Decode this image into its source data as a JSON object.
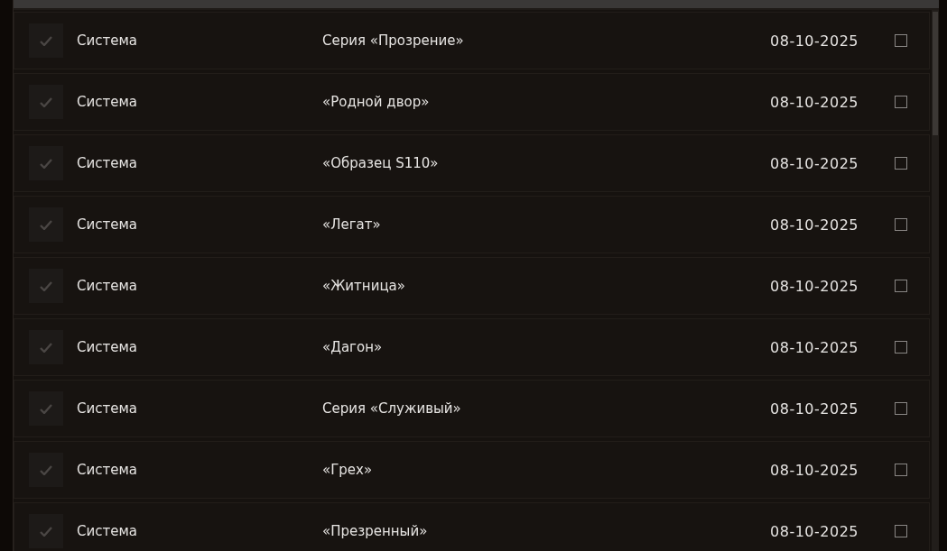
{
  "messages": [
    {
      "sender": "Система",
      "subject": "Серия «Прозрение»",
      "date": "08-10-2025",
      "checked": false
    },
    {
      "sender": "Система",
      "subject": "«Родной двор»",
      "date": "08-10-2025",
      "checked": false
    },
    {
      "sender": "Система",
      "subject": "«Образец S110»",
      "date": "08-10-2025",
      "checked": false
    },
    {
      "sender": "Система",
      "subject": "«Легат»",
      "date": "08-10-2025",
      "checked": false
    },
    {
      "sender": "Система",
      "subject": "«Житница»",
      "date": "08-10-2025",
      "checked": false
    },
    {
      "sender": "Система",
      "subject": "«Дагон»",
      "date": "08-10-2025",
      "checked": false
    },
    {
      "sender": "Система",
      "subject": "Серия «Служивый»",
      "date": "08-10-2025",
      "checked": false
    },
    {
      "sender": "Система",
      "subject": "«Грех»",
      "date": "08-10-2025",
      "checked": false
    },
    {
      "sender": "Система",
      "subject": "«Презренный»",
      "date": "08-10-2025",
      "checked": false
    }
  ]
}
